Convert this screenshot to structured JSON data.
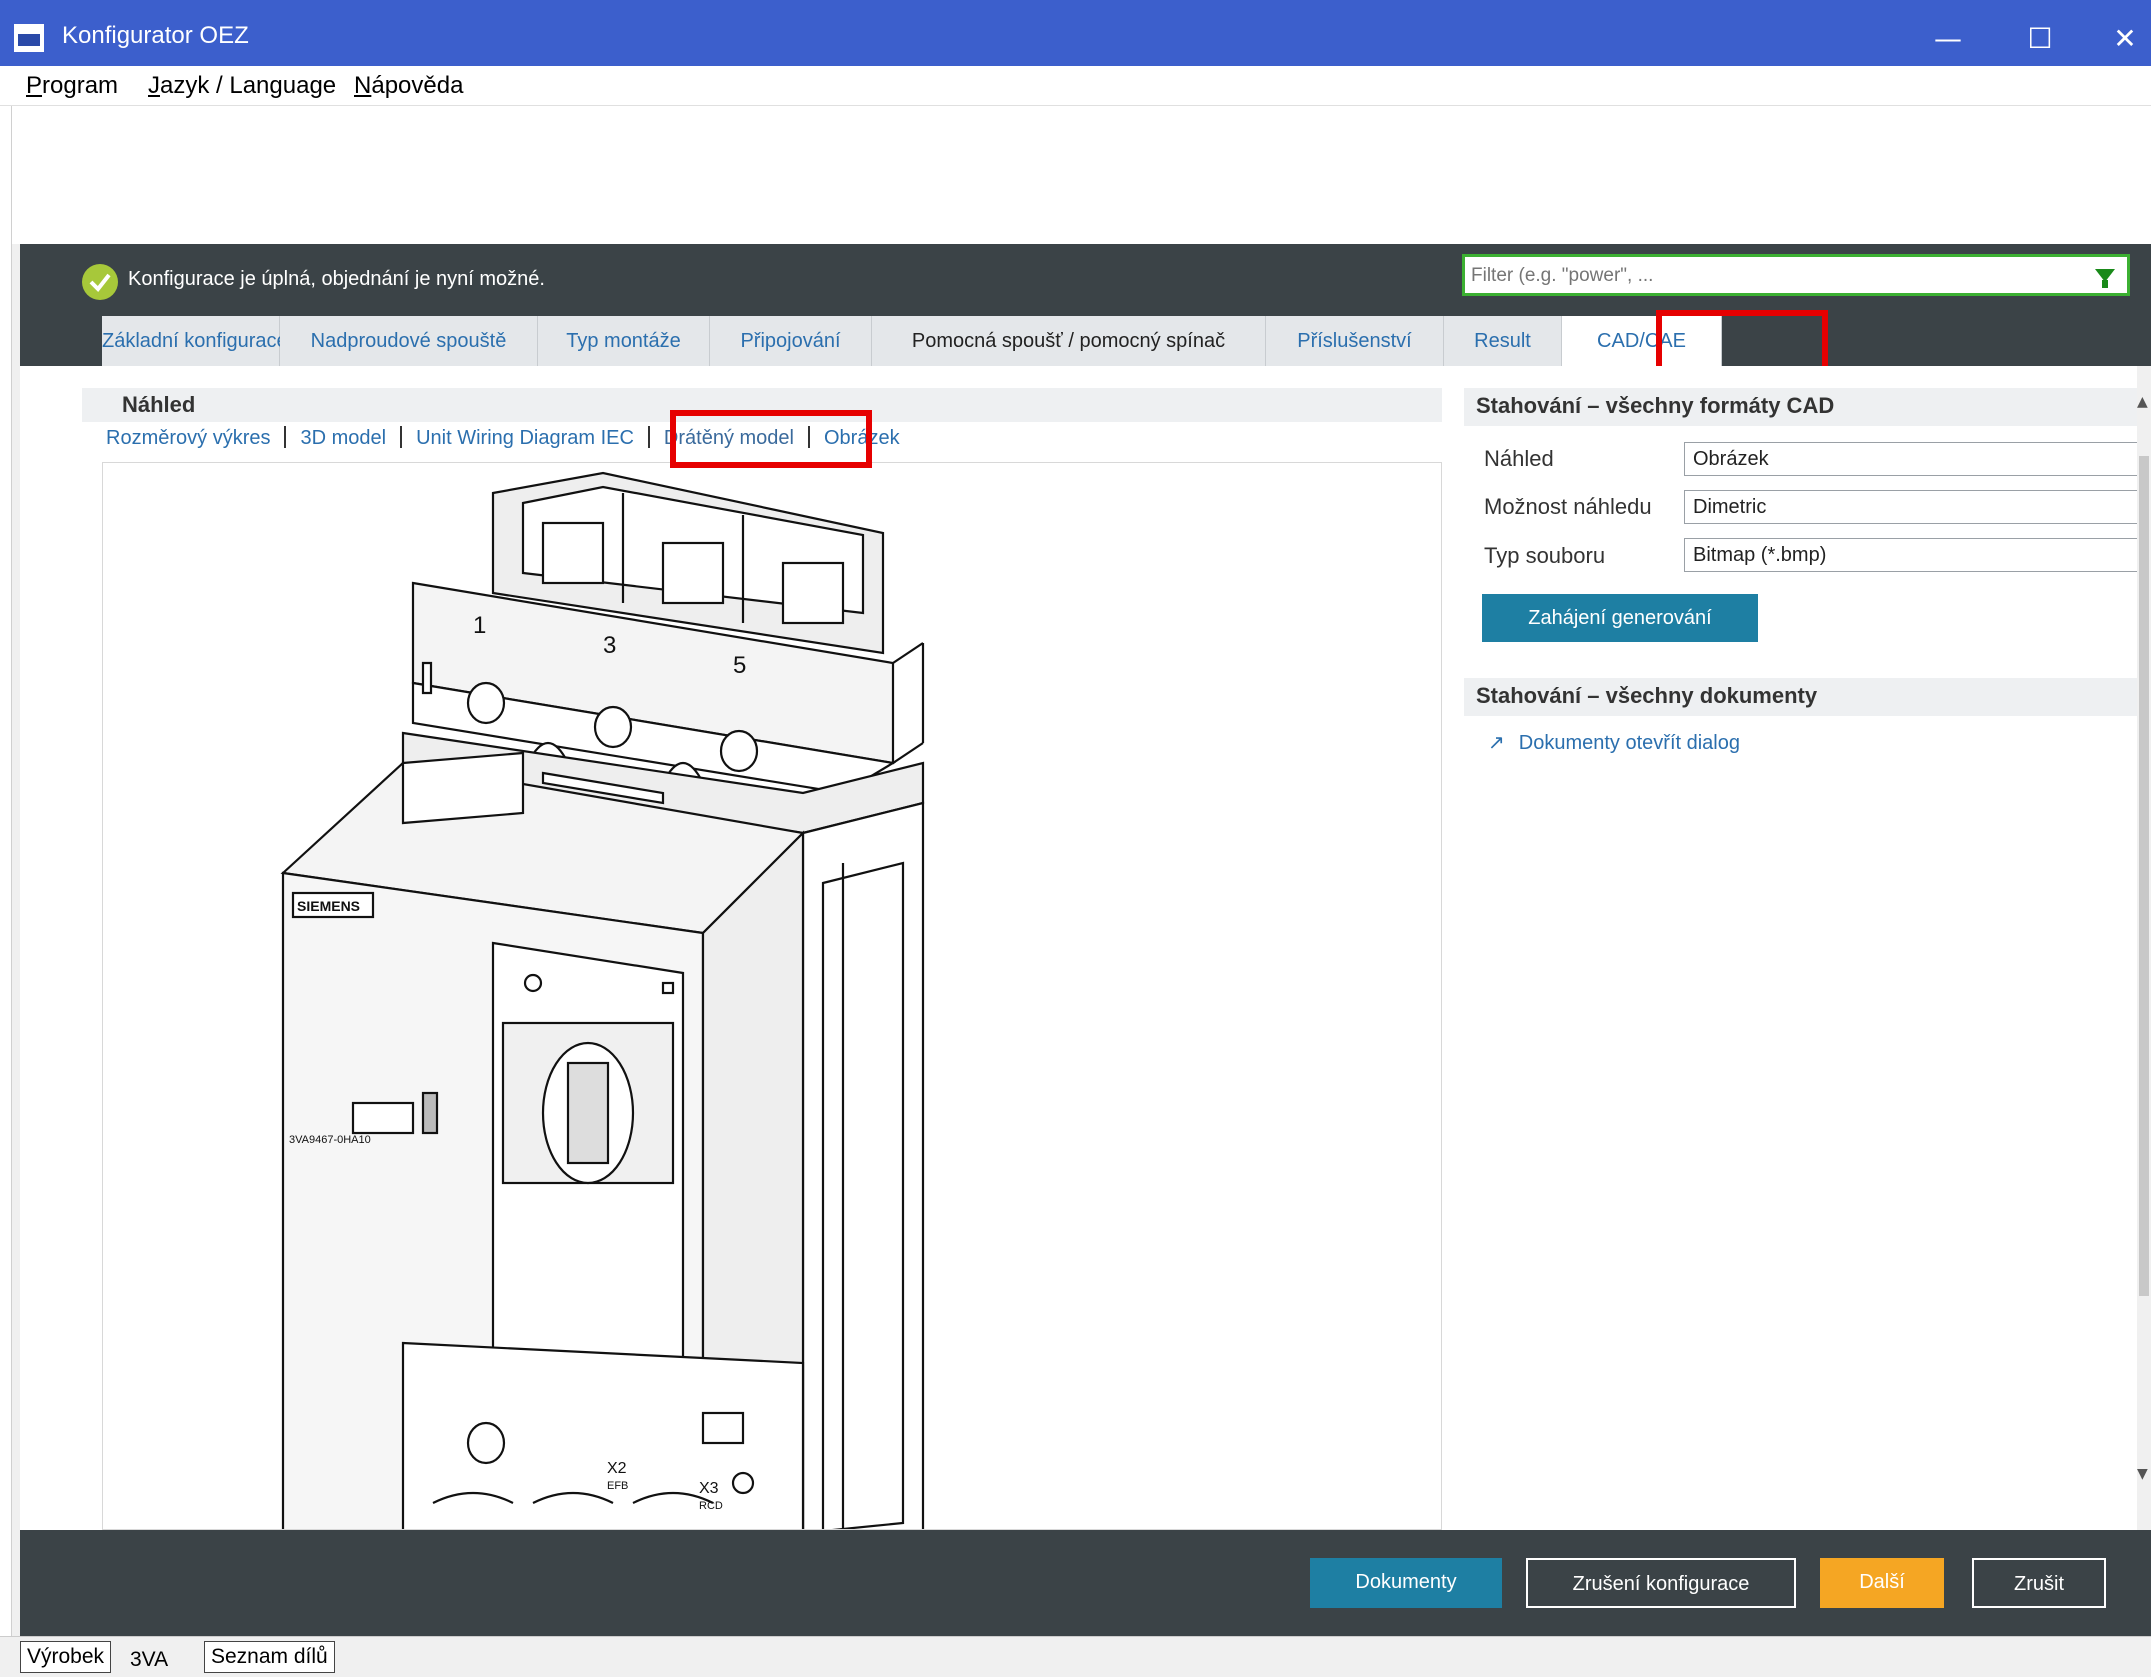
{
  "window": {
    "title": "Konfigurator OEZ",
    "controls": {
      "minimize": "—",
      "maximize": "☐",
      "close": "✕"
    }
  },
  "menu": {
    "items": [
      {
        "label": "Program",
        "underline": "P",
        "rest": "rogram"
      },
      {
        "label": "Jazyk / Language",
        "underline": "J",
        "rest": "azyk / Language"
      },
      {
        "label": "Nápověda",
        "underline": "N",
        "rest": "ápověda"
      }
    ]
  },
  "status": {
    "message": "Konfigurace je úplná, objednání je nyní možné.",
    "icon": "check-circle-icon",
    "color": "#a7c83a"
  },
  "filter": {
    "placeholder": "Filter (e.g. \"power\", ...",
    "icon": "funnel-icon"
  },
  "tabs": [
    {
      "label": "Základní konfigurace"
    },
    {
      "label": "Nadproudové spouště"
    },
    {
      "label": "Typ montáže"
    },
    {
      "label": "Připojování"
    },
    {
      "label": "Pomocná spoušť / pomocný spínač"
    },
    {
      "label": "Příslušenství"
    },
    {
      "label": "Result"
    },
    {
      "label": "CAD/CAE",
      "active": true
    }
  ],
  "preview": {
    "heading": "Náhled",
    "view_links": [
      "Rozměrový výkres",
      "3D model",
      "Unit Wiring Diagram IEC",
      "Drátěný model",
      "Obrázek"
    ],
    "drawing": {
      "brand": "SIEMENS",
      "part_code": "3VA9467-0HA10",
      "terminal_labels": [
        "1",
        "3",
        "5"
      ],
      "connector_labels": [
        {
          "id": "X2",
          "sub": "EFB"
        },
        {
          "id": "X3",
          "sub": "RCD"
        }
      ]
    }
  },
  "cad_download": {
    "heading": "Stahování – všechny formáty CAD",
    "fields": [
      {
        "label": "Náhled",
        "value": "Obrázek"
      },
      {
        "label": "Možnost náhledu",
        "value": "Dimetric"
      },
      {
        "label": "Typ souboru",
        "value": "Bitmap (*.bmp)"
      }
    ],
    "generate_button": "Zahájení generování"
  },
  "docs_download": {
    "heading": "Stahování – všechny dokumenty",
    "link": "Dokumenty otevřít dialog",
    "icon": "arrow-up-right-icon"
  },
  "footer": {
    "documents": "Dokumenty",
    "cancel_config": "Zrušení konfigurace",
    "next": "Další",
    "cancel": "Zrušit"
  },
  "bottom_tabs": [
    "Výrobek",
    "3VA",
    "Seznam dílů"
  ],
  "colors": {
    "titlebar": "#3c5fcc",
    "header": "#3b4347",
    "accent_blue": "#1e7fa3",
    "next_orange": "#f5a623",
    "highlight_red": "#e60000",
    "filter_green": "#3cb032"
  }
}
